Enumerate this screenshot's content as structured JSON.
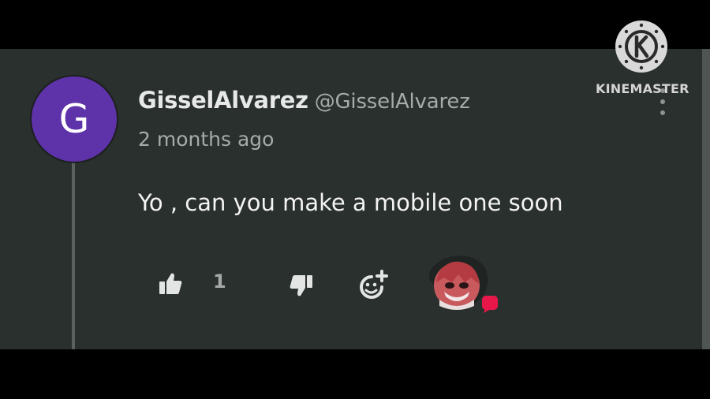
{
  "comment": {
    "avatar_letter": "G",
    "author_name": "GisselAlvarez",
    "author_handle": "@GisselAlvarez",
    "timestamp": "2 months ago",
    "text": "Yo , can you make a mobile one soon"
  },
  "actions": {
    "like_count": "1",
    "like_icon": "thumbs-up-icon",
    "dislike_icon": "thumbs-down-icon",
    "reply_icon": "reply-emoji-icon"
  },
  "watermark": {
    "text": "KINEMASTER"
  },
  "colors": {
    "panel_bg": "#2a302e",
    "avatar_bg": "#5e32a8",
    "text_primary": "#f3f4f3",
    "text_secondary": "#a6abaa",
    "sticker_badge": "#e8174a"
  }
}
